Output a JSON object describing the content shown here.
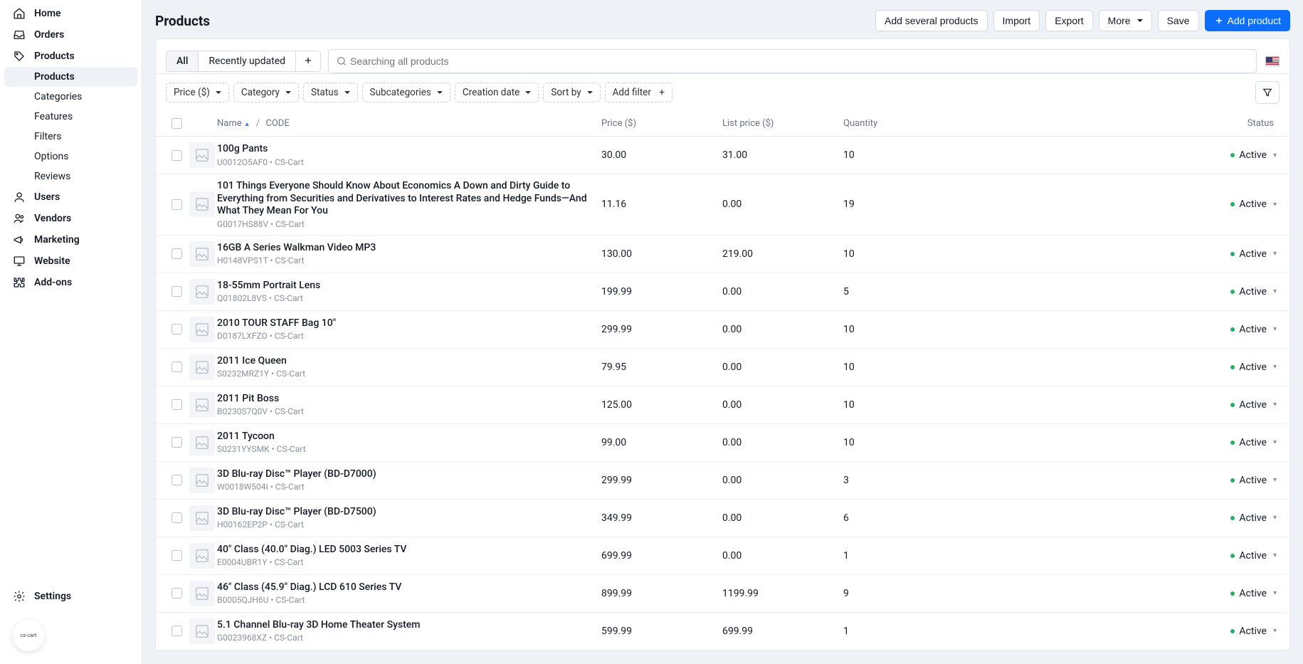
{
  "page": {
    "title": "Products"
  },
  "sidebar": {
    "items": [
      {
        "label": "Home"
      },
      {
        "label": "Orders"
      },
      {
        "label": "Products",
        "children": [
          {
            "label": "Products",
            "active": true
          },
          {
            "label": "Categories"
          },
          {
            "label": "Features"
          },
          {
            "label": "Filters"
          },
          {
            "label": "Options"
          },
          {
            "label": "Reviews"
          }
        ]
      },
      {
        "label": "Users"
      },
      {
        "label": "Vendors"
      },
      {
        "label": "Marketing"
      },
      {
        "label": "Website"
      },
      {
        "label": "Add-ons"
      }
    ],
    "settings_label": "Settings",
    "badge": "cs-cart"
  },
  "header": {
    "buttons": {
      "add_several": "Add several products",
      "import": "Import",
      "export": "Export",
      "more": "More",
      "save": "Save",
      "add_product": "Add product"
    }
  },
  "tabs": {
    "all": "All",
    "recently": "Recently updated"
  },
  "search": {
    "placeholder": "Searching all products"
  },
  "filters": {
    "price": "Price ($)",
    "category": "Category",
    "status": "Status",
    "subcategories": "Subcategories",
    "creation": "Creation date",
    "sort": "Sort by",
    "add": "Add filter"
  },
  "columns": {
    "name": "Name",
    "code": "CODE",
    "price": "Price ($)",
    "list_price": "List price ($)",
    "quantity": "Quantity",
    "status": "Status"
  },
  "status_label": "Active",
  "vendor": "CS-Cart",
  "rows": [
    {
      "name": "100g Pants",
      "code": "U0012O5AF0",
      "price": "30.00",
      "list": "31.00",
      "qty": "10"
    },
    {
      "name": "101 Things Everyone Should Know About Economics A Down and Dirty Guide to Everything from Securities and Derivatives to Interest Rates and Hedge Funds—And What They Mean For You",
      "code": "G0017HS88V",
      "price": "11.16",
      "list": "0.00",
      "qty": "19"
    },
    {
      "name": "16GB A Series Walkman Video MP3",
      "code": "H0148VPS1T",
      "price": "130.00",
      "list": "219.00",
      "qty": "10"
    },
    {
      "name": "18-55mm Portrait Lens",
      "code": "Q01802L8VS",
      "price": "199.99",
      "list": "0.00",
      "qty": "5"
    },
    {
      "name": "2010 TOUR STAFF Bag 10\"",
      "code": "D0187LXFZO",
      "price": "299.99",
      "list": "0.00",
      "qty": "10"
    },
    {
      "name": "2011 Ice Queen",
      "code": "S0232MRZ1Y",
      "price": "79.95",
      "list": "0.00",
      "qty": "10"
    },
    {
      "name": "2011 Pit Boss",
      "code": "B0230S7Q0V",
      "price": "125.00",
      "list": "0.00",
      "qty": "10"
    },
    {
      "name": "2011 Tycoon",
      "code": "S0231YYSMK",
      "price": "99.00",
      "list": "0.00",
      "qty": "10"
    },
    {
      "name": "3D Blu-ray Disc™ Player (BD-D7000)",
      "code": "W0018W504I",
      "price": "299.99",
      "list": "0.00",
      "qty": "3"
    },
    {
      "name": "3D Blu-ray Disc™ Player (BD-D7500)",
      "code": "H00162EP2P",
      "price": "349.99",
      "list": "0.00",
      "qty": "6"
    },
    {
      "name": "40\" Class (40.0\" Diag.) LED 5003 Series TV",
      "code": "E0004UBR1Y",
      "price": "699.99",
      "list": "0.00",
      "qty": "1"
    },
    {
      "name": "46\" Class (45.9\" Diag.) LCD 610 Series TV",
      "code": "B0005QJH6U",
      "price": "899.99",
      "list": "1199.99",
      "qty": "9"
    },
    {
      "name": "5.1 Channel Blu-ray 3D Home Theater System",
      "code": "G0023968XZ",
      "price": "599.99",
      "list": "699.99",
      "qty": "1"
    }
  ]
}
